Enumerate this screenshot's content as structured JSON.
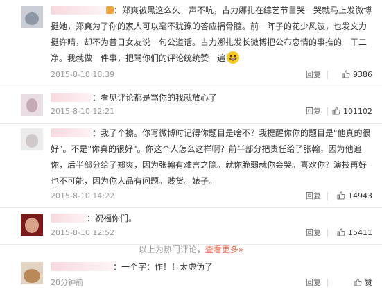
{
  "comments": [
    {
      "text": "：郑爽被黑这么久一声不吭，古力娜扎在综艺节目哭一哭就马上发微博挺她，郑爽为了你的家人可以毫不犹豫的答应捐骨髓。前一阵子的花少风波，也发文力挺许晴，却不为昔日女友说一句公道话。古力娜扎发长微博把公布恋情的事推的一干二净。我就做一件事，把骂你们的评论统统赞一遍",
      "emoji": "grinning-emoji",
      "time": "2015-8-10 18:39",
      "reply": "回复",
      "likes": "9386"
    },
    {
      "text": "：看见评论都是骂你的我就放心了",
      "time": "2015-8-10 12:21",
      "reply": "回复",
      "likes": "101102"
    },
    {
      "text": "：我了个擦。你写微博时记得你题目是啥不？我提醒你你的题目是\"他真的很好\"。不是\"你真的很好\"。你这个人怎么这样啊？前半部分把责任给了张翰，因为他追你，后半部分给了郑爽，因为张翰有难言之隐。就你脆弱就你会哭。喜欢你？演技再好也不可能，因为你人品有问题。贱货。婊子。",
      "time": "2015-8-10 14:22",
      "reply": "回复",
      "likes": "14943"
    },
    {
      "text": "：祝福你们。",
      "time": "2015-8-10 12:52",
      "reply": "回复",
      "likes": "15411"
    },
    {
      "text": "：一个字：作！！太虚伪了",
      "time": "20分钟前",
      "reply": "回复",
      "likes": "赞"
    }
  ],
  "hot_footer": {
    "prefix": "以上为热门评论，",
    "more": "查看更多»"
  },
  "colors": {
    "accent": "#eb7350",
    "meta": "#999999",
    "text": "#333333"
  }
}
